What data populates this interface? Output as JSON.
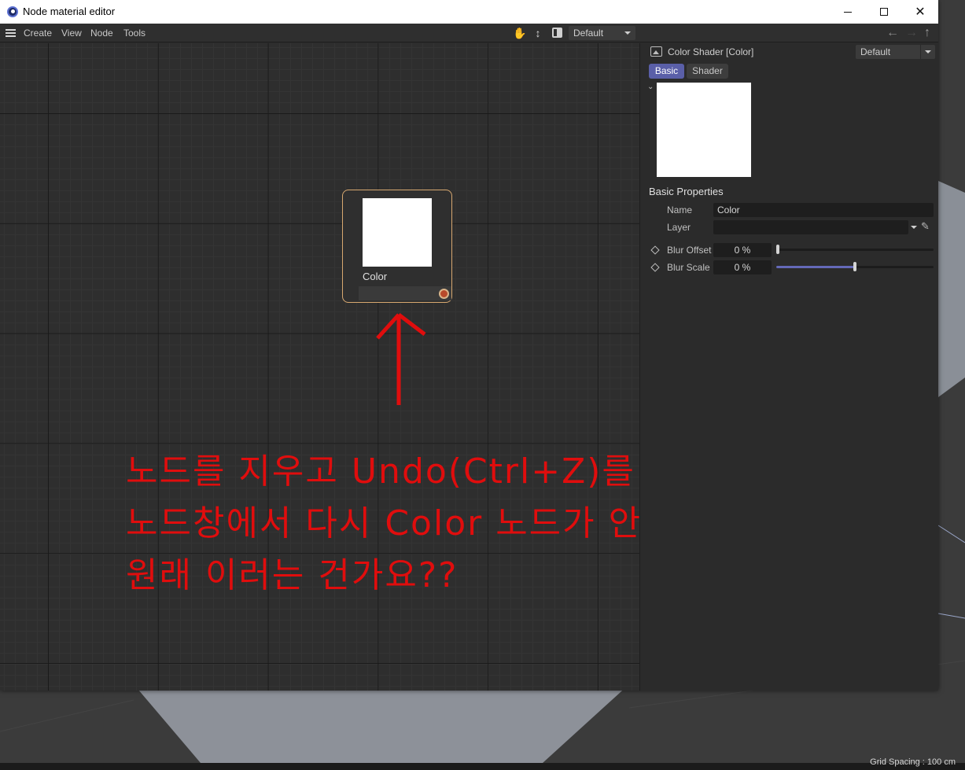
{
  "window": {
    "title": "Node material editor"
  },
  "menubar": {
    "items": [
      "Create",
      "View",
      "Node",
      "Tools"
    ],
    "layout_value": "Default"
  },
  "canvas": {
    "node_label": "Color"
  },
  "annotation": {
    "lines": [
      "노드를 지우고 Undo(Ctrl+Z)를 누르면",
      "노드창에서 다시 Color 노드가 안생기는데",
      "원래 이러는 건가요??"
    ],
    "color": "#e00d0d"
  },
  "attributes": {
    "title": "Color Shader [Color]",
    "mode_value": "Default",
    "tabs": [
      "Basic",
      "Shader"
    ],
    "active_tab": "Basic",
    "section_heading": "Basic Properties",
    "name_label": "Name",
    "name_value": "Color",
    "layer_label": "Layer",
    "layer_value": "",
    "blur_offset_label": "Blur Offset",
    "blur_offset_value": "0 %",
    "blur_offset_slider": 0,
    "blur_scale_label": "Blur Scale",
    "blur_scale_value": "0 %",
    "blur_scale_slider": 0.5
  },
  "viewport": {
    "grid_spacing": "Grid Spacing : 100 cm"
  },
  "colors": {
    "accent": "#5a5fa8",
    "node_border": "#d7a870",
    "port": "#b84a2b"
  }
}
